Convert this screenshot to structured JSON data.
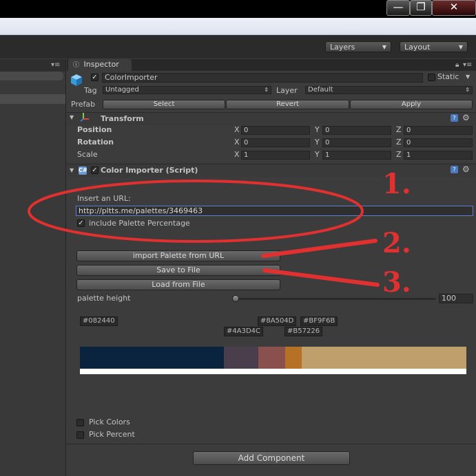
{
  "window": {
    "minimize_glyph": "—",
    "maximize_glyph": "❐",
    "close_glyph": "✕"
  },
  "toolbar": {
    "layers_label": "Layers",
    "layout_label": "Layout"
  },
  "inspector": {
    "tab_label": "Inspector",
    "object_name": "ColorImporter",
    "static_label": "Static",
    "tag_label": "Tag",
    "tag_value": "Untagged",
    "layer_label": "Layer",
    "layer_value": "Default",
    "prefab_label": "Prefab",
    "prefab_select": "Select",
    "prefab_revert": "Revert",
    "prefab_apply": "Apply"
  },
  "transform": {
    "title": "Transform",
    "rows": [
      {
        "label": "Position",
        "x": "0",
        "y": "0",
        "z": "0"
      },
      {
        "label": "Rotation",
        "x": "0",
        "y": "0",
        "z": "0"
      },
      {
        "label": "Scale",
        "x": "1",
        "y": "1",
        "z": "1"
      }
    ],
    "axis_x": "X",
    "axis_y": "Y",
    "axis_z": "Z"
  },
  "script": {
    "title": "Color Importer (Script)",
    "url_prompt": "Insert an URL:",
    "url_value": "http://pltts.me/palettes/3469463",
    "include_percentage_label": "include Palette Percentage",
    "import_button": "import Palette from URL",
    "save_button": "Save to File",
    "load_button": "Load from File",
    "palette_height_label": "palette height",
    "palette_height_value": "100",
    "pick_colors_label": "Pick Colors",
    "pick_percent_label": "Pick Percent"
  },
  "palette": {
    "hex_labels": [
      "#082440",
      "#4A3D4C",
      "#8A504D",
      "#B57226",
      "#BF9F6B"
    ],
    "swatches": [
      {
        "hex": "#0a2440",
        "percent": 37.2
      },
      {
        "hex": "#4a3d4c",
        "percent": 8.9
      },
      {
        "hex": "#8a504d",
        "percent": 7.0
      },
      {
        "hex": "#b57226",
        "percent": 4.3
      },
      {
        "hex": "#bf9f6b",
        "percent": 42.6
      }
    ]
  },
  "add_component_label": "Add Component",
  "annotations": {
    "step1": "1.",
    "step2": "2.",
    "step3": "3.",
    "color": "#e03030"
  }
}
